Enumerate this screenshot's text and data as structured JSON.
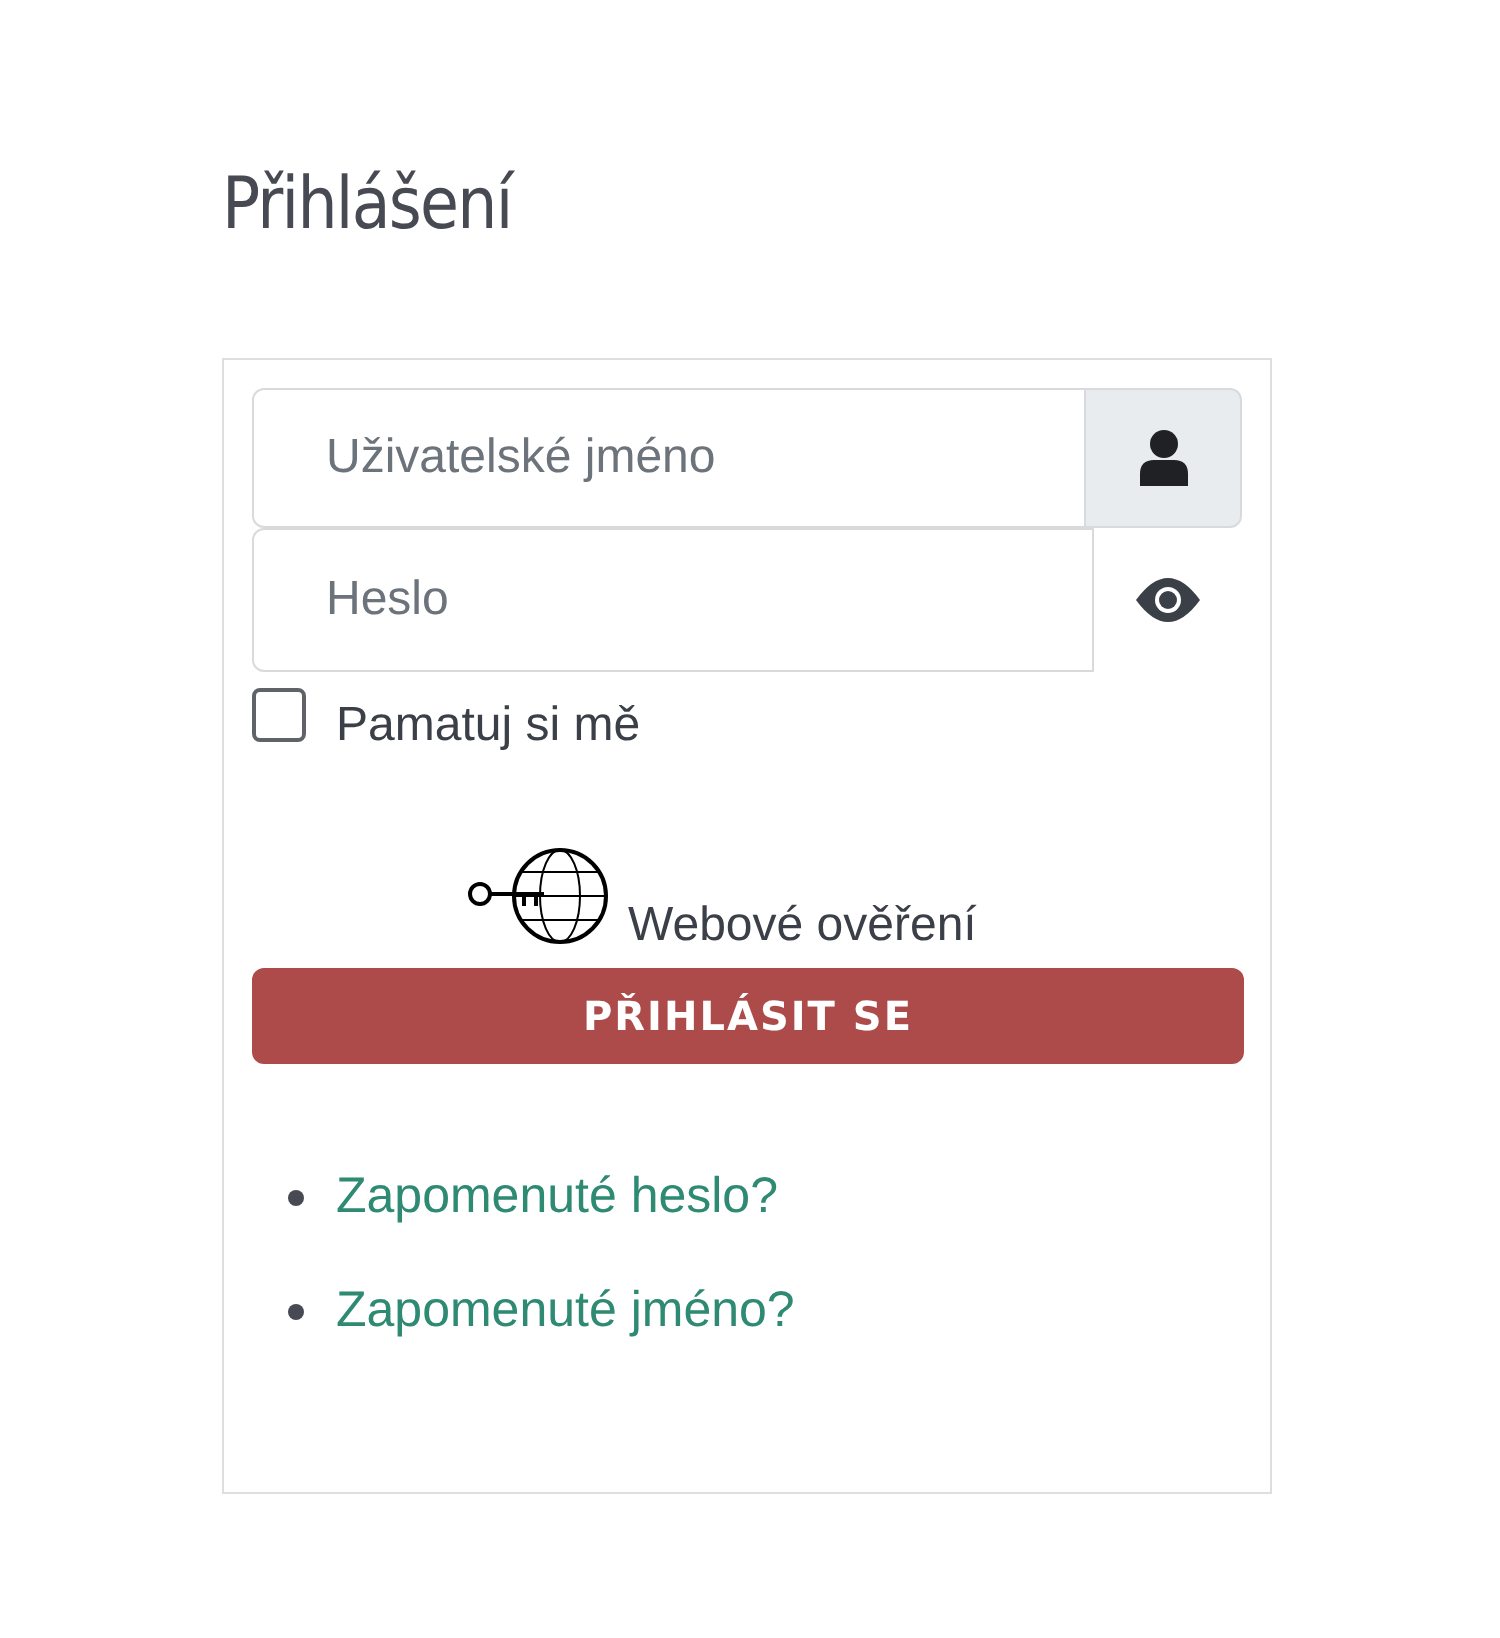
{
  "title": "Přihlášení",
  "username": {
    "placeholder": "Uživatelské jméno"
  },
  "password": {
    "placeholder": "Heslo"
  },
  "remember": {
    "label": "Pamatuj si mě",
    "checked": false
  },
  "web_auth": {
    "label": "Webové ověření"
  },
  "submit": {
    "label": "PŘIHLÁSIT SE"
  },
  "links": [
    {
      "label": "Zapomenuté heslo?"
    },
    {
      "label": "Zapomenuté jméno?"
    }
  ]
}
